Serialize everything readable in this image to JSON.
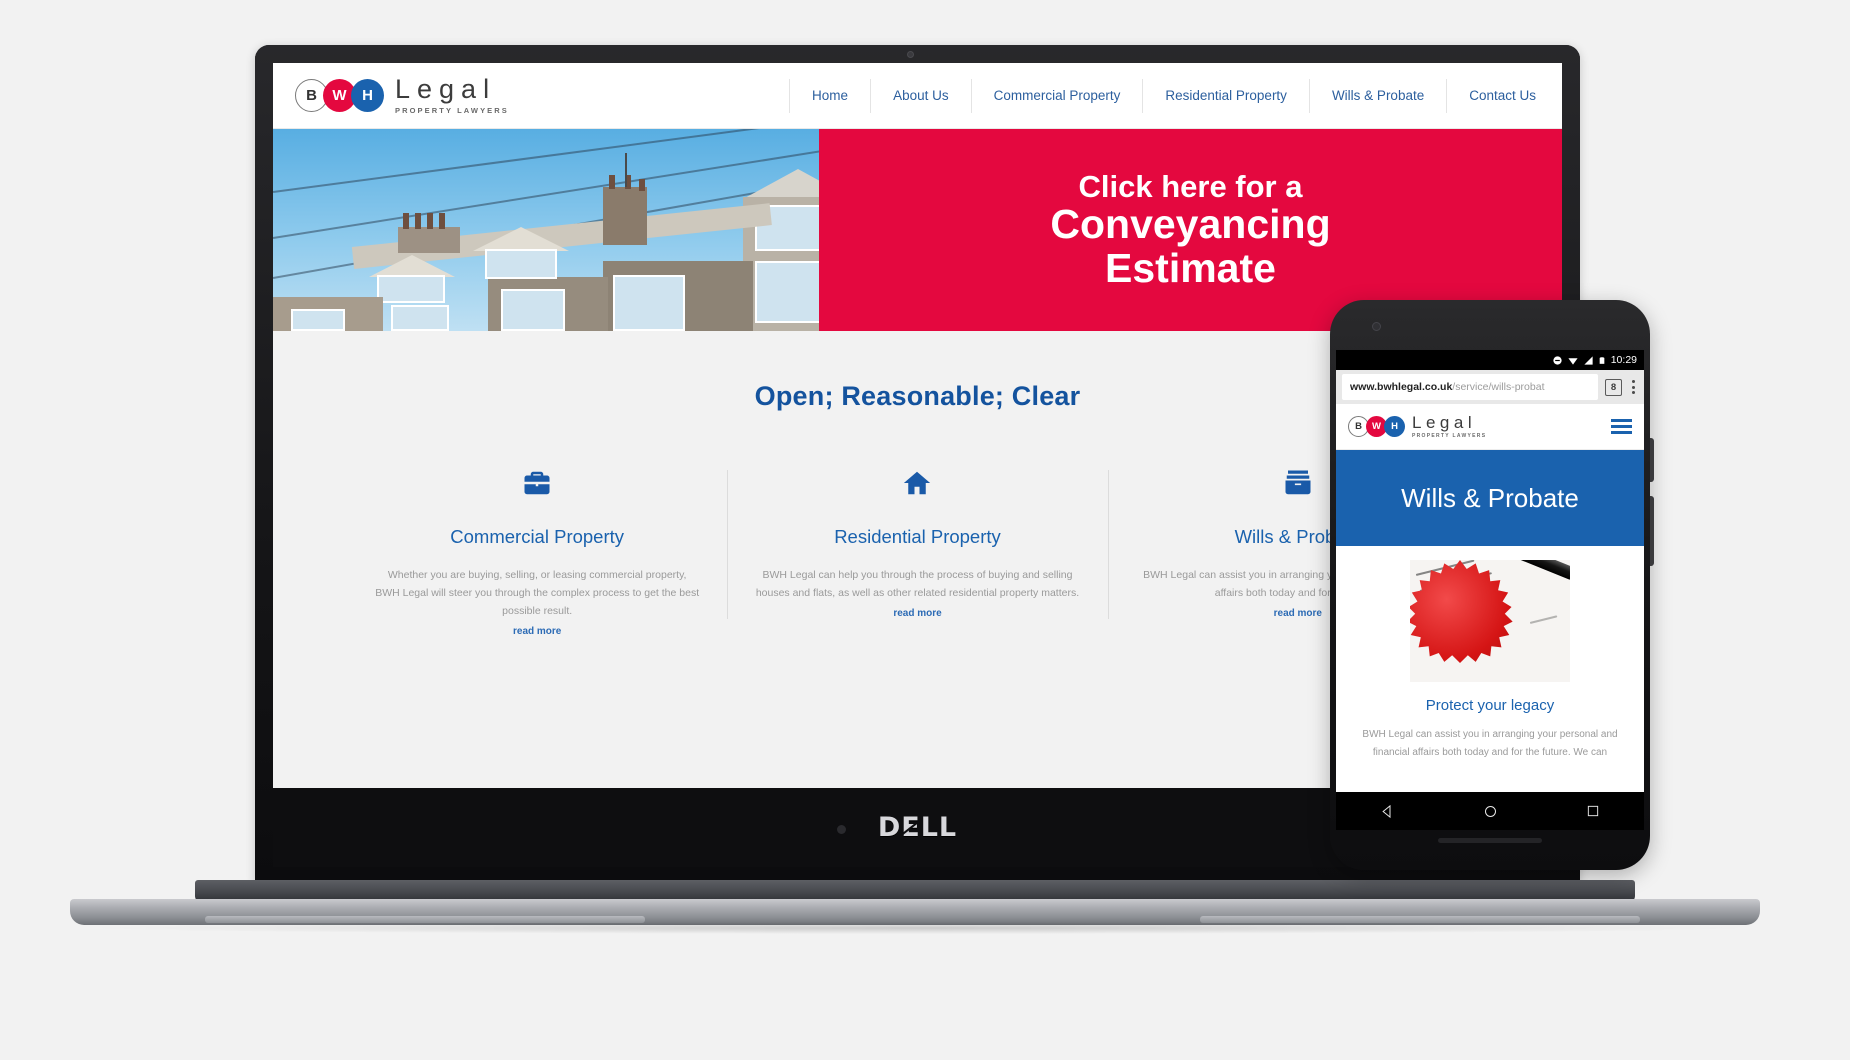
{
  "desktop": {
    "brand": {
      "letters": [
        "B",
        "W",
        "H"
      ],
      "name": "Legal",
      "tagline": "PROPERTY LAWYERS",
      "colors": {
        "red": "#e4083f",
        "blue": "#1a62ae"
      }
    },
    "nav": [
      {
        "label": "Home"
      },
      {
        "label": "About Us"
      },
      {
        "label": "Commercial Property"
      },
      {
        "label": "Residential Property"
      },
      {
        "label": "Wills & Probate"
      },
      {
        "label": "Contact Us"
      }
    ],
    "hero": {
      "photo_alt": "Row of terraced houses with dormer windows against blue sky",
      "cta_line1": "Click here for a",
      "cta_line2": "Conveyancing",
      "cta_line3": "Estimate",
      "cta_background": "#e4083f"
    },
    "tagline": "Open; Reasonable; Clear",
    "services": [
      {
        "icon": "briefcase-icon",
        "title": "Commercial Property",
        "text": "Whether you are buying, selling, or leasing commercial property, BWH Legal will steer you through the complex process to get the best possible result.",
        "more": "read more"
      },
      {
        "icon": "house-icon",
        "title": "Residential Property",
        "text": "BWH Legal can help you through the process of buying and selling houses and flats, as well as other related residential property matters.",
        "more": "read more"
      },
      {
        "icon": "archive-box-icon",
        "title": "Wills & Probate",
        "text": "BWH Legal can assist you in arranging your personal and financial affairs both today and for the future.",
        "more": "read more"
      }
    ]
  },
  "laptop": {
    "vendor_logo": "DELL"
  },
  "phone": {
    "status": {
      "time": "10:29",
      "icons": [
        "do-not-disturb-icon",
        "wifi-icon",
        "signal-icon",
        "battery-icon"
      ]
    },
    "browser": {
      "url_domain": "www.bwhlegal.co.uk",
      "url_path": "/service/wills-probat",
      "tab_count": "8",
      "menu_icon": "kebab-menu-icon"
    },
    "header": {
      "letters": [
        "B",
        "W",
        "H"
      ],
      "name": "Legal",
      "tagline": "PROPERTY LAWYERS",
      "menu_icon": "hamburger-icon"
    },
    "banner": {
      "title": "Wills & Probate",
      "background": "#1a62ae"
    },
    "content": {
      "photo_alt": "Legal document with red wax seal and fountain pen",
      "heading": "Protect your legacy",
      "paragraph": "BWH Legal can assist you in arranging your personal and financial affairs both today and for the future. We can"
    },
    "navbar": [
      "back-icon",
      "home-icon",
      "recents-icon"
    ]
  }
}
